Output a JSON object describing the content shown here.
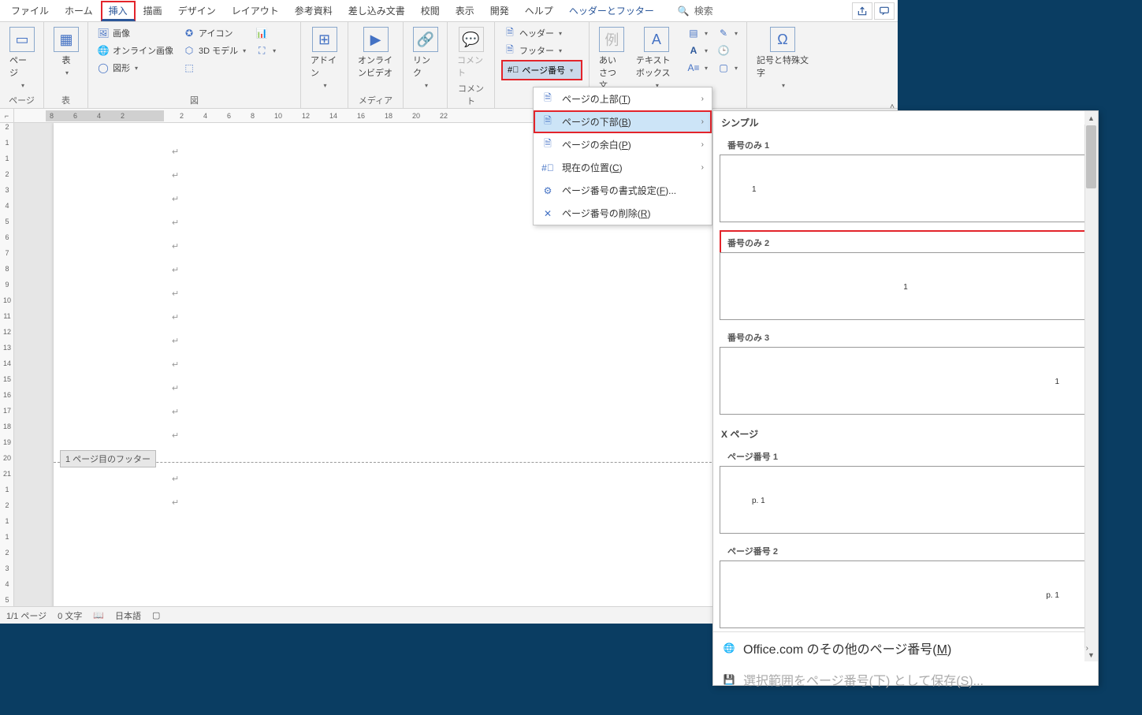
{
  "tabs": {
    "file": "ファイル",
    "home": "ホーム",
    "insert": "挿入",
    "draw": "描画",
    "design": "デザイン",
    "layout": "レイアウト",
    "references": "参考資料",
    "mailings": "差し込み文書",
    "review": "校閲",
    "view": "表示",
    "developer": "開発",
    "help": "ヘルプ",
    "headerfooter": "ヘッダーとフッター",
    "search": "検索"
  },
  "ribbon": {
    "pages": {
      "label": "ページ",
      "btn": "ページ"
    },
    "tables": {
      "label": "表",
      "btn": "表"
    },
    "illustrations": {
      "label": "図",
      "picture": "画像",
      "online_pic": "オンライン画像",
      "shapes": "図形",
      "icons": "アイコン",
      "models3d": "3D モデル",
      "smartart_icon": "⬚",
      "chart_icon": "📊",
      "screenshot_icon": "⛶"
    },
    "addins": {
      "label": "アドイン",
      "btn": "アドイン"
    },
    "media": {
      "label": "メディア",
      "btn": "オンラインビデオ"
    },
    "links": {
      "label": "リンク",
      "btn": "リンク"
    },
    "comments": {
      "label": "コメント",
      "btn": "コメント"
    },
    "headerfooter": {
      "header": "ヘッダー",
      "footer": "フッター",
      "pagenum": "ページ番号"
    },
    "text": {
      "greeting": "あいさつ文",
      "textbox": "テキストボックス"
    },
    "symbols": {
      "label": "記号と特殊文字",
      "btn": "記号と特殊文字"
    }
  },
  "page_num_menu": {
    "top": "ページの上部(T)",
    "bottom": "ページの下部(B)",
    "margin": "ページの余白(P)",
    "current": "現在の位置(C)",
    "format": "ページ番号の書式設定(F)...",
    "remove": "ページ番号の削除(R)"
  },
  "gallery": {
    "simple_header": "シンプル",
    "only1": "番号のみ 1",
    "only2": "番号のみ 2",
    "only3": "番号のみ 3",
    "xpage_header": "X ページ",
    "pn1": "ページ番号 1",
    "pn2": "ページ番号 2",
    "sample_center": "1",
    "sample_p1": "p. 1",
    "office_more": "Office.com のその他のページ番号(M)",
    "save_selection": "選択範囲をページ番号(下) として保存(S)..."
  },
  "doc": {
    "footer_tag": "1 ページ目のフッター"
  },
  "status": {
    "page": "1/1 ページ",
    "words": "0 文字",
    "lang": "日本語",
    "focus": "フォーカス"
  },
  "ruler_h": [
    "8",
    "6",
    "4",
    "2",
    "2",
    "4",
    "6",
    "8",
    "10",
    "12",
    "14",
    "16",
    "18",
    "20",
    "22"
  ],
  "ruler_v": [
    "2",
    "1",
    "1",
    "2",
    "3",
    "4",
    "5",
    "6",
    "7",
    "8",
    "9",
    "10",
    "11",
    "12",
    "13",
    "14",
    "15",
    "16",
    "17",
    "18",
    "19",
    "20",
    "21",
    "1",
    "2",
    "1",
    "1",
    "2",
    "3",
    "4",
    "5"
  ]
}
